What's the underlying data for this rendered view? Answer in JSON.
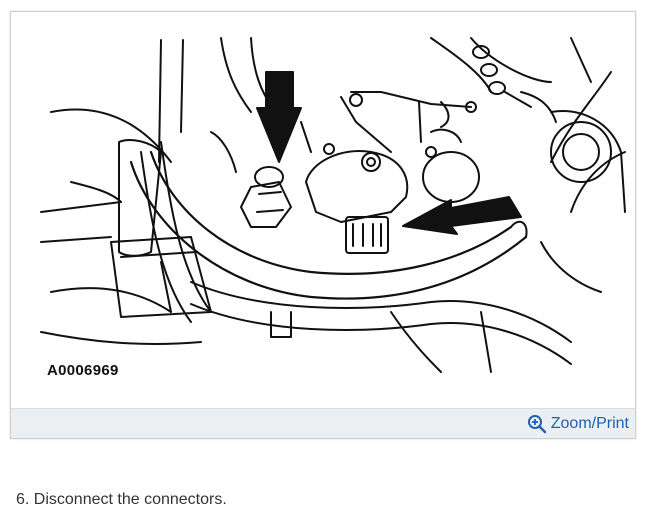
{
  "figure": {
    "image_id": "A0006969",
    "zoom_label": "Zoom/Print",
    "zoom_icon": "zoom-in-icon",
    "link_color": "#1f5fb4"
  },
  "instruction": {
    "text": "6. Disconnect the connectors."
  }
}
